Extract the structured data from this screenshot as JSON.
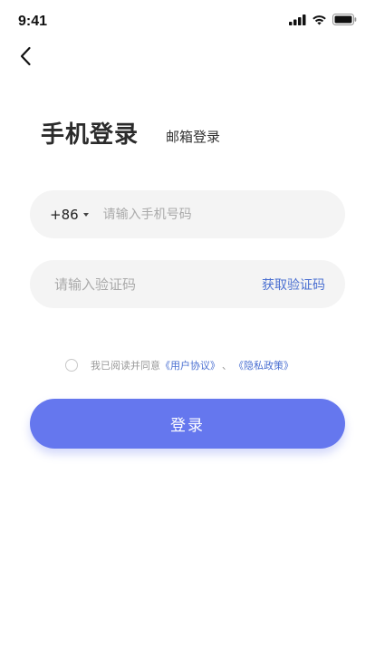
{
  "status_bar": {
    "time": "9:41",
    "icons": [
      "signal-icon",
      "wifi-icon",
      "battery-icon"
    ]
  },
  "nav": {
    "back_icon": "chevron-left-icon"
  },
  "tabs": {
    "active_label": "手机登录",
    "inactive_label": "邮箱登录"
  },
  "phone": {
    "country_code": "+86",
    "value": "",
    "placeholder": "请输入手机号码"
  },
  "code": {
    "value": "",
    "placeholder": "请输入验证码",
    "get_code_label": "获取验证码"
  },
  "agreement": {
    "prefix": "我已阅读并同意",
    "user_agreement": "《用户协议》",
    "separator": "、",
    "privacy_policy": "《隐私政策》",
    "checked": false
  },
  "login_button": {
    "label": "登录"
  },
  "colors": {
    "accent": "#6577ee",
    "link": "#4a6fd1",
    "field_bg": "#f4f4f4"
  }
}
